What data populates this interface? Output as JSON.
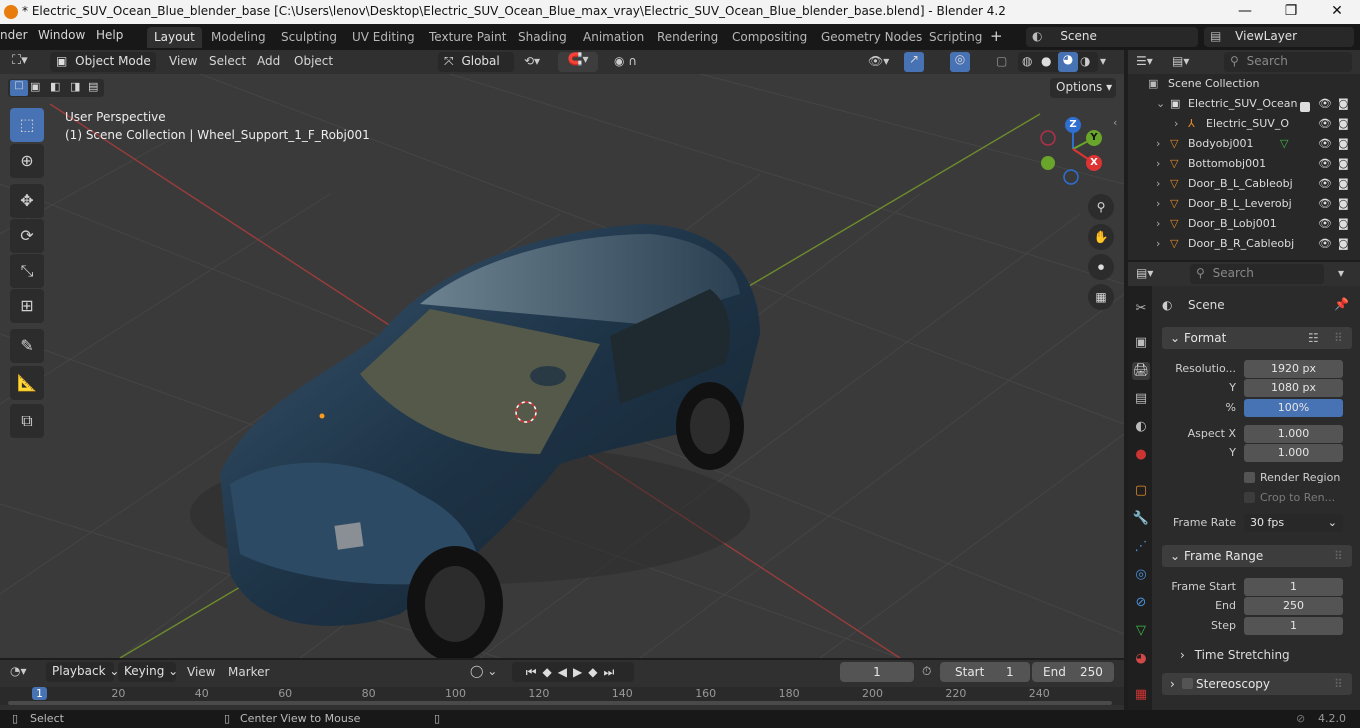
{
  "title_bar": {
    "text": "* Electric_SUV_Ocean_Blue_blender_base [C:\\Users\\lenov\\Desktop\\Electric_SUV_Ocean_Blue_max_vray\\Electric_SUV_Ocean_Blue_blender_base.blend] - Blender 4.2",
    "minimize": "—",
    "maximize": "❐",
    "close": "✕"
  },
  "menu": {
    "items": [
      "nder",
      "Window",
      "Help"
    ]
  },
  "workspaces": [
    "Layout",
    "Modeling",
    "Sculpting",
    "UV Editing",
    "Texture Paint",
    "Shading",
    "Animation",
    "Rendering",
    "Compositing",
    "Geometry Nodes",
    "Scripting"
  ],
  "active_workspace": "Layout",
  "scene_field": "Scene",
  "viewlayer_field": "ViewLayer",
  "viewport_header": {
    "mode": "Object Mode",
    "menus": [
      "View",
      "Select",
      "Add",
      "Object"
    ],
    "transform_orientation": "Global",
    "options": "Options"
  },
  "viewport": {
    "perspective": "User Perspective",
    "context": "(1) Scene Collection | Wheel_Support_1_F_Robj001",
    "gizmo": {
      "x": "X",
      "y": "Y",
      "z": "Z"
    }
  },
  "outliner": {
    "search_placeholder": "Search",
    "root": "Scene Collection",
    "rows": [
      {
        "name": "Electric_SUV_Ocean",
        "indent": 1,
        "expanded": true,
        "type": "collection"
      },
      {
        "name": "Electric_SUV_O",
        "indent": 2,
        "expanded": false,
        "type": "armature"
      },
      {
        "name": "Bodyobj001",
        "indent": 1,
        "expanded": false,
        "type": "mesh"
      },
      {
        "name": "Bottomobj001",
        "indent": 1,
        "expanded": false,
        "type": "mesh"
      },
      {
        "name": "Door_B_L_Cableobj",
        "indent": 1,
        "expanded": false,
        "type": "mesh"
      },
      {
        "name": "Door_B_L_Leverobj",
        "indent": 1,
        "expanded": false,
        "type": "mesh"
      },
      {
        "name": "Door_B_Lobj001",
        "indent": 1,
        "expanded": false,
        "type": "mesh"
      },
      {
        "name": "Door_B_R_Cableobj",
        "indent": 1,
        "expanded": false,
        "type": "mesh"
      }
    ]
  },
  "properties": {
    "search_placeholder": "Search",
    "context": "Scene",
    "format": {
      "title": "Format",
      "res_x_label": "Resolutio...",
      "res_x": "1920 px",
      "res_y_label": "Y",
      "res_y": "1080 px",
      "pct_label": "%",
      "pct": "100%",
      "aspect_x_label": "Aspect X",
      "aspect_x": "1.000",
      "aspect_y_label": "Y",
      "aspect_y": "1.000",
      "render_region": "Render Region",
      "crop": "Crop to Ren...",
      "frame_rate_label": "Frame Rate",
      "frame_rate": "30 fps"
    },
    "frame_range": {
      "title": "Frame Range",
      "start_label": "Frame Start",
      "start": "1",
      "end_label": "End",
      "end": "250",
      "step_label": "Step",
      "step": "1"
    },
    "time_stretching": "Time Stretching",
    "stereoscopy": "Stereoscopy"
  },
  "timeline": {
    "menus": [
      "Playback",
      "Keying",
      "View",
      "Marker"
    ],
    "current_frame": "1",
    "start_label": "Start",
    "start": "1",
    "end_label": "End",
    "end": "250",
    "ruler": [
      "1",
      "20",
      "40",
      "60",
      "80",
      "100",
      "120",
      "140",
      "160",
      "180",
      "200",
      "220",
      "240"
    ]
  },
  "status_bar": {
    "select": "Select",
    "center": "Center View to Mouse",
    "version": "4.2.0"
  }
}
